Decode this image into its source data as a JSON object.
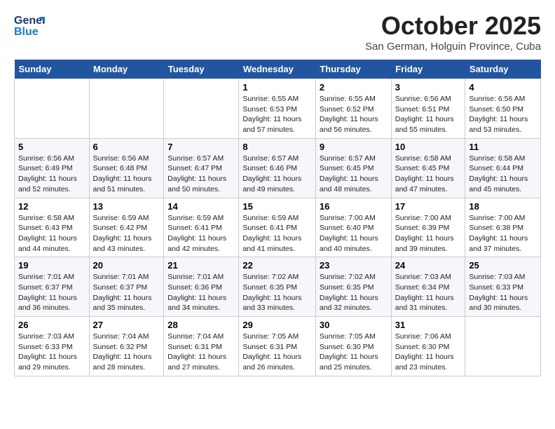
{
  "header": {
    "logo_line1": "General",
    "logo_line2": "Blue",
    "month": "October 2025",
    "location": "San German, Holguin Province, Cuba"
  },
  "days": [
    "Sunday",
    "Monday",
    "Tuesday",
    "Wednesday",
    "Thursday",
    "Friday",
    "Saturday"
  ],
  "weeks": [
    [
      {
        "date": "",
        "sunrise": "",
        "sunset": "",
        "daylight": ""
      },
      {
        "date": "",
        "sunrise": "",
        "sunset": "",
        "daylight": ""
      },
      {
        "date": "",
        "sunrise": "",
        "sunset": "",
        "daylight": ""
      },
      {
        "date": "1",
        "sunrise": "Sunrise: 6:55 AM",
        "sunset": "Sunset: 6:53 PM",
        "daylight": "Daylight: 11 hours and 57 minutes."
      },
      {
        "date": "2",
        "sunrise": "Sunrise: 6:55 AM",
        "sunset": "Sunset: 6:52 PM",
        "daylight": "Daylight: 11 hours and 56 minutes."
      },
      {
        "date": "3",
        "sunrise": "Sunrise: 6:56 AM",
        "sunset": "Sunset: 6:51 PM",
        "daylight": "Daylight: 11 hours and 55 minutes."
      },
      {
        "date": "4",
        "sunrise": "Sunrise: 6:56 AM",
        "sunset": "Sunset: 6:50 PM",
        "daylight": "Daylight: 11 hours and 53 minutes."
      }
    ],
    [
      {
        "date": "5",
        "sunrise": "Sunrise: 6:56 AM",
        "sunset": "Sunset: 6:49 PM",
        "daylight": "Daylight: 11 hours and 52 minutes."
      },
      {
        "date": "6",
        "sunrise": "Sunrise: 6:56 AM",
        "sunset": "Sunset: 6:48 PM",
        "daylight": "Daylight: 11 hours and 51 minutes."
      },
      {
        "date": "7",
        "sunrise": "Sunrise: 6:57 AM",
        "sunset": "Sunset: 6:47 PM",
        "daylight": "Daylight: 11 hours and 50 minutes."
      },
      {
        "date": "8",
        "sunrise": "Sunrise: 6:57 AM",
        "sunset": "Sunset: 6:46 PM",
        "daylight": "Daylight: 11 hours and 49 minutes."
      },
      {
        "date": "9",
        "sunrise": "Sunrise: 6:57 AM",
        "sunset": "Sunset: 6:45 PM",
        "daylight": "Daylight: 11 hours and 48 minutes."
      },
      {
        "date": "10",
        "sunrise": "Sunrise: 6:58 AM",
        "sunset": "Sunset: 6:45 PM",
        "daylight": "Daylight: 11 hours and 47 minutes."
      },
      {
        "date": "11",
        "sunrise": "Sunrise: 6:58 AM",
        "sunset": "Sunset: 6:44 PM",
        "daylight": "Daylight: 11 hours and 45 minutes."
      }
    ],
    [
      {
        "date": "12",
        "sunrise": "Sunrise: 6:58 AM",
        "sunset": "Sunset: 6:43 PM",
        "daylight": "Daylight: 11 hours and 44 minutes."
      },
      {
        "date": "13",
        "sunrise": "Sunrise: 6:59 AM",
        "sunset": "Sunset: 6:42 PM",
        "daylight": "Daylight: 11 hours and 43 minutes."
      },
      {
        "date": "14",
        "sunrise": "Sunrise: 6:59 AM",
        "sunset": "Sunset: 6:41 PM",
        "daylight": "Daylight: 11 hours and 42 minutes."
      },
      {
        "date": "15",
        "sunrise": "Sunrise: 6:59 AM",
        "sunset": "Sunset: 6:41 PM",
        "daylight": "Daylight: 11 hours and 41 minutes."
      },
      {
        "date": "16",
        "sunrise": "Sunrise: 7:00 AM",
        "sunset": "Sunset: 6:40 PM",
        "daylight": "Daylight: 11 hours and 40 minutes."
      },
      {
        "date": "17",
        "sunrise": "Sunrise: 7:00 AM",
        "sunset": "Sunset: 6:39 PM",
        "daylight": "Daylight: 11 hours and 39 minutes."
      },
      {
        "date": "18",
        "sunrise": "Sunrise: 7:00 AM",
        "sunset": "Sunset: 6:38 PM",
        "daylight": "Daylight: 11 hours and 37 minutes."
      }
    ],
    [
      {
        "date": "19",
        "sunrise": "Sunrise: 7:01 AM",
        "sunset": "Sunset: 6:37 PM",
        "daylight": "Daylight: 11 hours and 36 minutes."
      },
      {
        "date": "20",
        "sunrise": "Sunrise: 7:01 AM",
        "sunset": "Sunset: 6:37 PM",
        "daylight": "Daylight: 11 hours and 35 minutes."
      },
      {
        "date": "21",
        "sunrise": "Sunrise: 7:01 AM",
        "sunset": "Sunset: 6:36 PM",
        "daylight": "Daylight: 11 hours and 34 minutes."
      },
      {
        "date": "22",
        "sunrise": "Sunrise: 7:02 AM",
        "sunset": "Sunset: 6:35 PM",
        "daylight": "Daylight: 11 hours and 33 minutes."
      },
      {
        "date": "23",
        "sunrise": "Sunrise: 7:02 AM",
        "sunset": "Sunset: 6:35 PM",
        "daylight": "Daylight: 11 hours and 32 minutes."
      },
      {
        "date": "24",
        "sunrise": "Sunrise: 7:03 AM",
        "sunset": "Sunset: 6:34 PM",
        "daylight": "Daylight: 11 hours and 31 minutes."
      },
      {
        "date": "25",
        "sunrise": "Sunrise: 7:03 AM",
        "sunset": "Sunset: 6:33 PM",
        "daylight": "Daylight: 11 hours and 30 minutes."
      }
    ],
    [
      {
        "date": "26",
        "sunrise": "Sunrise: 7:03 AM",
        "sunset": "Sunset: 6:33 PM",
        "daylight": "Daylight: 11 hours and 29 minutes."
      },
      {
        "date": "27",
        "sunrise": "Sunrise: 7:04 AM",
        "sunset": "Sunset: 6:32 PM",
        "daylight": "Daylight: 11 hours and 28 minutes."
      },
      {
        "date": "28",
        "sunrise": "Sunrise: 7:04 AM",
        "sunset": "Sunset: 6:31 PM",
        "daylight": "Daylight: 11 hours and 27 minutes."
      },
      {
        "date": "29",
        "sunrise": "Sunrise: 7:05 AM",
        "sunset": "Sunset: 6:31 PM",
        "daylight": "Daylight: 11 hours and 26 minutes."
      },
      {
        "date": "30",
        "sunrise": "Sunrise: 7:05 AM",
        "sunset": "Sunset: 6:30 PM",
        "daylight": "Daylight: 11 hours and 25 minutes."
      },
      {
        "date": "31",
        "sunrise": "Sunrise: 7:06 AM",
        "sunset": "Sunset: 6:30 PM",
        "daylight": "Daylight: 11 hours and 23 minutes."
      },
      {
        "date": "",
        "sunrise": "",
        "sunset": "",
        "daylight": ""
      }
    ]
  ]
}
